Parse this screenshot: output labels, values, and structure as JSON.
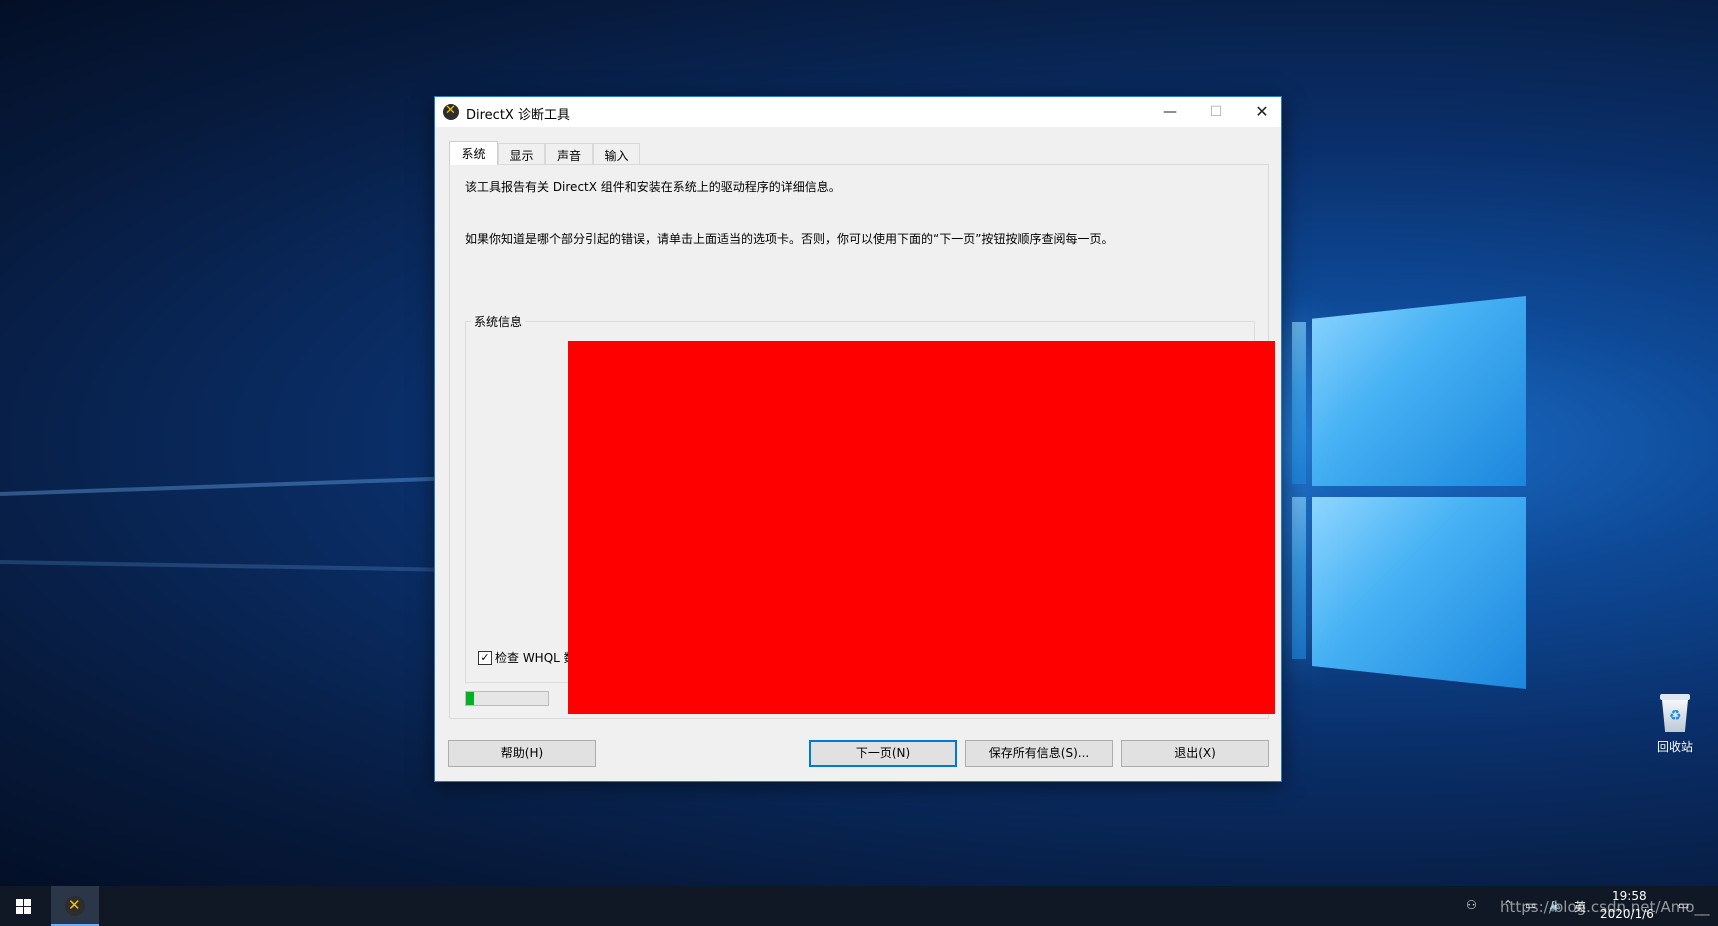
{
  "window": {
    "title": "DirectX 诊断工具",
    "minimize_icon": "—",
    "maximize_icon": "☐",
    "close_icon": "✕"
  },
  "tabs": [
    {
      "label": "系统",
      "active": true
    },
    {
      "label": "显示",
      "active": false
    },
    {
      "label": "声音",
      "active": false
    },
    {
      "label": "输入",
      "active": false
    }
  ],
  "panel": {
    "intro": "该工具报告有关 DirectX 组件和安装在系统上的驱动程序的详细信息。",
    "instructions": "如果你知道是哪个部分引起的错误，请单击上面适当的选项卡。否则，你可以使用下面的“下一页”按钮按顺序查阅每一页。",
    "group_title": "系统信息",
    "whql_label": "检查 WHQL 数",
    "whql_checked": true,
    "progress_fraction": 0.1
  },
  "buttons": {
    "help": "帮助(H)",
    "next": "下一页(N)",
    "save": "保存所有信息(S)...",
    "exit": "退出(X)"
  },
  "desktop": {
    "recycle_bin_label": "回收站"
  },
  "taskbar": {
    "tray_icons": [
      "people-icon",
      "chevron-up-icon",
      "network-icon",
      "volume-icon"
    ],
    "ime_label": "英",
    "time": "19:58",
    "date": "2020/1/6",
    "watermark": "https://blog.csdn.net/Amo__"
  },
  "colors": {
    "accent": "#0078d7",
    "redaction": "#ff0000",
    "progress_fill": "#06b025"
  }
}
